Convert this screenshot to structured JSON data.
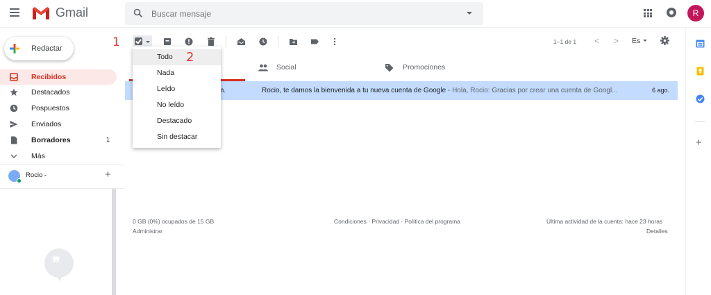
{
  "app": {
    "name": "Gmail"
  },
  "search": {
    "placeholder": "Buscar mensaje"
  },
  "account": {
    "initial": "R"
  },
  "compose": {
    "label": "Redactar"
  },
  "annotations": {
    "one": "1",
    "two": "2"
  },
  "nav": {
    "items": [
      {
        "label": "Recibidos",
        "icon": "inbox-icon",
        "count": ""
      },
      {
        "label": "Destacados",
        "icon": "star-icon",
        "count": ""
      },
      {
        "label": "Pospuestos",
        "icon": "clock-icon",
        "count": ""
      },
      {
        "label": "Enviados",
        "icon": "send-icon",
        "count": ""
      },
      {
        "label": "Borradores",
        "icon": "draft-icon",
        "count": "1"
      },
      {
        "label": "Más",
        "icon": "chevron-down-icon",
        "count": ""
      }
    ]
  },
  "hangouts": {
    "user": "Rocio -",
    "add": "+"
  },
  "toolbar": {
    "pager": "1–1 de 1",
    "prev": "<",
    "next": ">",
    "lang": "Es"
  },
  "tabs": [
    {
      "label": "Social",
      "icon": "people-icon"
    },
    {
      "label": "Promociones",
      "icon": "tag-icon"
    }
  ],
  "email": {
    "sender_partial": "m.",
    "subject": "Rocio, te damos la bienvenida a tu nueva cuenta de Google",
    "snippet": " - Hola, Rocio: Gracias por crear una cuenta de Googl...",
    "date": "6 ago."
  },
  "select_menu": {
    "items": [
      "Todo",
      "Nada",
      "Leído",
      "No leído",
      "Destacado",
      "Sin destacar"
    ],
    "highlighted": "Todo"
  },
  "footer": {
    "storage": "0 GB (0%) ocupados de 15 GB",
    "manage": "Administrar",
    "links": "Condiciones · Privacidad · Política del programa",
    "last_activity": "Última actividad de la cuenta: hace 23 horas",
    "details": "Detalles"
  },
  "colors": {
    "brand_red": "#d93025",
    "selected_row": "#c2dbff",
    "active_nav_bg": "#fce8e6",
    "annotation_red": "#e53935"
  }
}
